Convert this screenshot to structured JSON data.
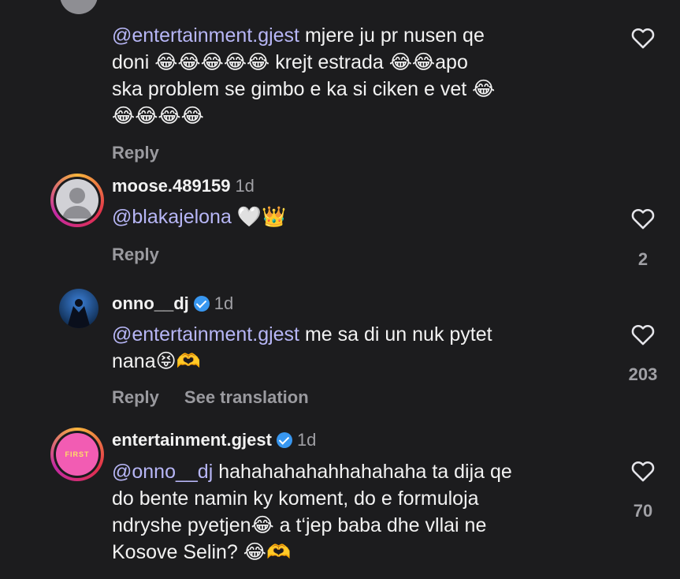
{
  "comments": [
    {
      "mention": "@entertainment.gjest",
      "lines": [
        " mjere ju pr nusen qe",
        "doni 😂😂😂😂😂 krejt estrada 😂😂apo",
        "ska problem se gimbo e ka si ciken e vet 😂",
        "😂😂😂😂"
      ],
      "reply_label": "Reply",
      "likes": ""
    },
    {
      "username": "moose.489159",
      "age": "1d",
      "mention": "@blakajelona",
      "text": " 🤍👑",
      "reply_label": "Reply",
      "likes": "2"
    },
    {
      "username": "onno__dj",
      "age": "1d",
      "mention": "@entertainment.gjest",
      "lines": [
        " me sa di un nuk pytet",
        "nana😝🫶"
      ],
      "reply_label": "Reply",
      "translate_label": "See translation",
      "likes": "203"
    },
    {
      "username": "entertainment.gjest",
      "age": "1d",
      "mention": "@onno__dj",
      "lines": [
        " hahahahahahhahahaha ta dija qe",
        "do bente namin ky koment, do e formuloja",
        "ndryshe pyetjen😂 a t‘jep baba dhe vllai ne",
        "Kosove Selin? 😂🫶"
      ],
      "likes": "70",
      "avatar_text": "FIRST"
    }
  ]
}
